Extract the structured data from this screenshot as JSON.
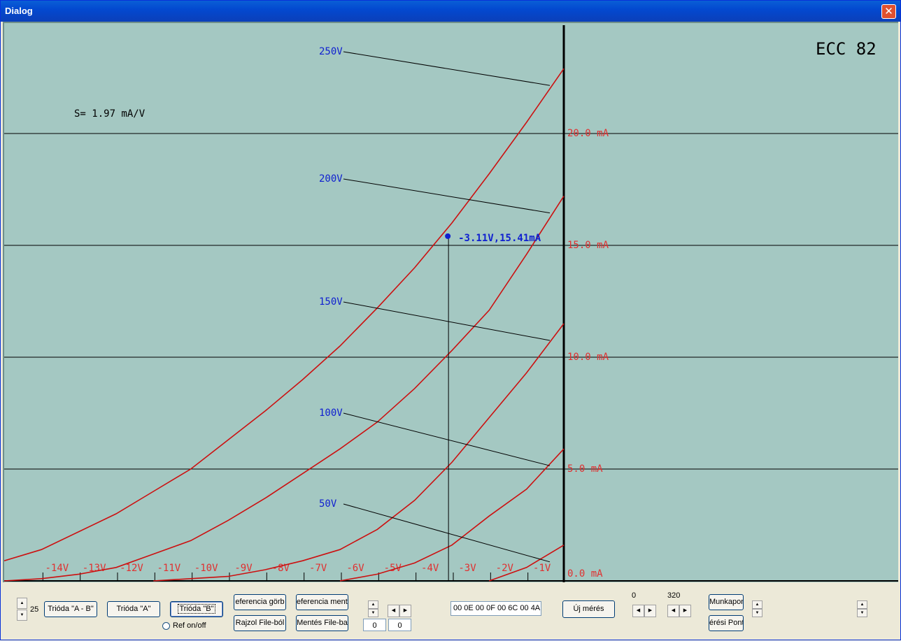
{
  "window": {
    "title": "Dialog",
    "close_icon": "close-icon"
  },
  "chart_data": {
    "type": "line",
    "title": "ECC 82",
    "slope_label": "S= 1.97 mA/V",
    "xlabel": "",
    "ylabel": "",
    "xlim": [
      -15,
      0
    ],
    "ylim": [
      0,
      25
    ],
    "x_ticks": [
      "-14V",
      "-13V",
      "-12V",
      "-11V",
      "-10V",
      "-9V",
      "-8V",
      "-7V",
      "-6V",
      "-5V",
      "-4V",
      "-3V",
      "-2V",
      "-1V"
    ],
    "y_ticks": [
      "0.0 mA",
      "5.0 mA",
      "10.0 mA",
      "15.0 mA",
      "20.0 mA"
    ],
    "grid": true,
    "series": [
      {
        "name": "250V",
        "x": [
          -15,
          -14,
          -13,
          -12,
          -11,
          -10,
          -9,
          -8,
          -7,
          -6,
          -5,
          -4,
          -3,
          -2,
          -1,
          0
        ],
        "y": [
          0.9,
          1.4,
          2.2,
          3.0,
          4.0,
          5.0,
          6.3,
          7.6,
          9.0,
          10.5,
          12.2,
          14.0,
          16.0,
          18.2,
          20.5,
          22.9
        ]
      },
      {
        "name": "200V",
        "x": [
          -15,
          -14,
          -13,
          -12,
          -11,
          -10,
          -9,
          -8,
          -7,
          -6,
          -5,
          -4,
          -3,
          -2,
          -1,
          0
        ],
        "y": [
          0.0,
          0.1,
          0.3,
          0.6,
          1.2,
          1.8,
          2.7,
          3.7,
          4.8,
          5.9,
          7.1,
          8.6,
          10.3,
          12.1,
          14.6,
          17.2
        ]
      },
      {
        "name": "150V",
        "x": [
          -11,
          -10,
          -9,
          -8,
          -7,
          -6,
          -5,
          -4,
          -3,
          -2,
          -1,
          0
        ],
        "y": [
          0.0,
          0.1,
          0.2,
          0.5,
          0.9,
          1.4,
          2.3,
          3.6,
          5.3,
          7.3,
          9.3,
          11.5
        ]
      },
      {
        "name": "100V",
        "x": [
          -6,
          -5,
          -4,
          -3,
          -2,
          -1,
          0
        ],
        "y": [
          0.0,
          0.3,
          0.8,
          1.6,
          2.9,
          4.1,
          5.9
        ]
      },
      {
        "name": "50V",
        "x": [
          -2,
          -1,
          0
        ],
        "y": [
          0.0,
          0.6,
          1.6
        ]
      }
    ],
    "series_labels": [
      "250V",
      "200V",
      "150V",
      "100V",
      "50V"
    ],
    "marker": {
      "x": -3.11,
      "y": 15.41,
      "label": "-3.11V,15.41mA"
    }
  },
  "toolbar": {
    "spin_value": "25",
    "btn_trioda_ab": "Trióda \"A - B\"",
    "btn_trioda_a": "Trióda  \"A\"",
    "btn_trioda_b": "Trióda  \"B\"",
    "radio_ref": "Ref on/off",
    "btn_ref_gorbe": "eferencia görb",
    "btn_rajzol": "Rajzol File-ból",
    "btn_ref_mentes": "eferencia menté",
    "btn_mentes": "Mentés File-ba",
    "edit_a": "0",
    "edit_b": "0",
    "hex_value": "00 0E 00 0F 00 6C 00 4A",
    "btn_uj_meres": "Új mérés",
    "label_0": "0",
    "label_320": "320",
    "btn_munkapont": "Munkapon",
    "btn_meresi_pont": "érési Pont"
  }
}
